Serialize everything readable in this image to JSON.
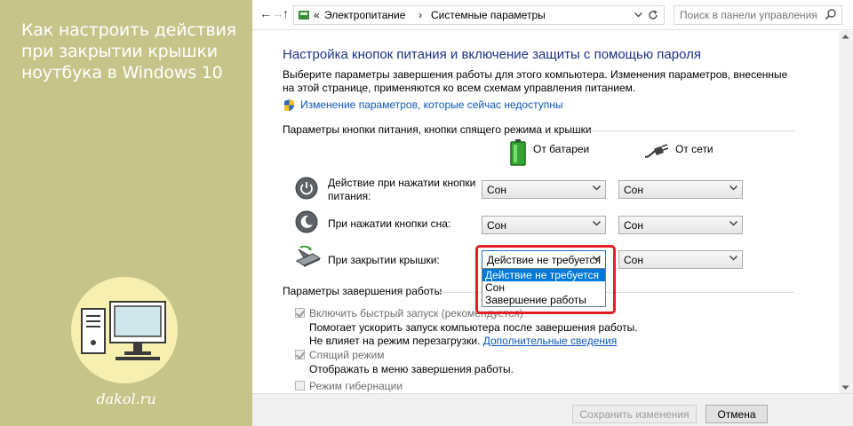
{
  "article": {
    "title": "Как настроить действия при закрытии крышки ноутбука в Windows 10",
    "brand": "dakol.ru"
  },
  "address_bar": {
    "back_glyph": "←",
    "forward_glyph": "→",
    "up_glyph": "↑",
    "overflow": "«",
    "crumb_1": "Электропитание",
    "separator": "›",
    "crumb_2": "Системные параметры",
    "search_placeholder": "Поиск в панели управления"
  },
  "page": {
    "heading": "Настройка кнопок питания и включение защиты с помощью пароля",
    "description": "Выберите параметры завершения работы для этого компьютера. Изменения параметров, внесенные на этой странице, применяются ко всем схемам управления питанием.",
    "change_link": "Изменение параметров, которые сейчас недоступны"
  },
  "power_buttons": {
    "section_title": "Параметры кнопки питания, кнопки спящего режима и крышки",
    "col_battery": "От батареи",
    "col_ac": "От сети",
    "rows": [
      {
        "label": "Действие при нажатии кнопки питания:",
        "battery": "Сон",
        "ac": "Сон"
      },
      {
        "label": "При нажатии кнопки сна:",
        "battery": "Сон",
        "ac": "Сон"
      },
      {
        "label": "При закрытии крышки:",
        "battery": "Действие не требуется",
        "ac": "Сон"
      }
    ],
    "dropdown_options": [
      "Действие не требуется",
      "Сон",
      "Завершение работы"
    ],
    "dropdown_selected_index": 0
  },
  "shutdown": {
    "section_title": "Параметры завершения работы",
    "fast_startup": {
      "label": "Включить быстрый запуск (рекомендуется)",
      "checked": true,
      "desc_prefix": "Помогает ускорить запуск компьютера после завершения работы. Не влияет на режим перезагрузки.",
      "desc_link": "Дополнительные сведения"
    },
    "sleep": {
      "label": "Спящий режим",
      "checked": true,
      "desc": "Отображать в меню завершения работы."
    },
    "hibernate": {
      "label": "Режим гибернации",
      "checked": false
    }
  },
  "footer": {
    "save_label": "Сохранить изменения",
    "cancel_label": "Отмена"
  },
  "colors": {
    "side_panel": "#c7c48a",
    "heading": "#1e3287",
    "link": "#0d57b5",
    "highlight": "#e31f26",
    "selection": "#0078d7"
  }
}
